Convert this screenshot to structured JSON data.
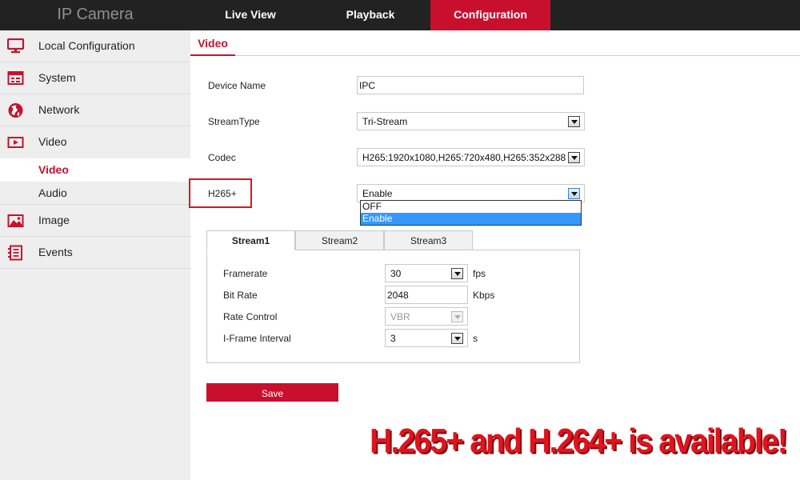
{
  "brand": "IP Camera",
  "nav": {
    "live_view": "Live View",
    "playback": "Playback",
    "configuration": "Configuration"
  },
  "colors": {
    "accent": "#c8102e",
    "topbar": "#222222",
    "sidebar": "#eeeeee",
    "highlight": "#3399ff"
  },
  "sidebar": {
    "local_configuration": "Local Configuration",
    "system": "System",
    "network": "Network",
    "video": "Video",
    "video_sub": "Video",
    "audio_sub": "Audio",
    "image": "Image",
    "events": "Events"
  },
  "content": {
    "tab": "Video",
    "device_name": {
      "label": "Device Name",
      "value": "IPC"
    },
    "stream_type": {
      "label": "StreamType",
      "value": "Tri-Stream"
    },
    "codec": {
      "label": "Codec",
      "value": "H265:1920x1080,H265:720x480,H265:352x288"
    },
    "h265plus": {
      "label": "H265+",
      "value": "Enable",
      "options": [
        "OFF",
        "Enable"
      ],
      "selected_option": "Enable"
    },
    "stream_tabs": [
      "Stream1",
      "Stream2",
      "Stream3"
    ],
    "active_stream_tab": "Stream1",
    "framerate": {
      "label": "Framerate",
      "value": "30",
      "unit": "fps"
    },
    "bit_rate": {
      "label": "Bit Rate",
      "value": "2048",
      "unit": "Kbps"
    },
    "rate_control": {
      "label": "Rate Control",
      "value": "VBR"
    },
    "iframe_interval": {
      "label": "I-Frame Interval",
      "value": "3",
      "unit": "s"
    },
    "save_label": "Save"
  },
  "banner": "H.265+ and H.264+ is available!"
}
